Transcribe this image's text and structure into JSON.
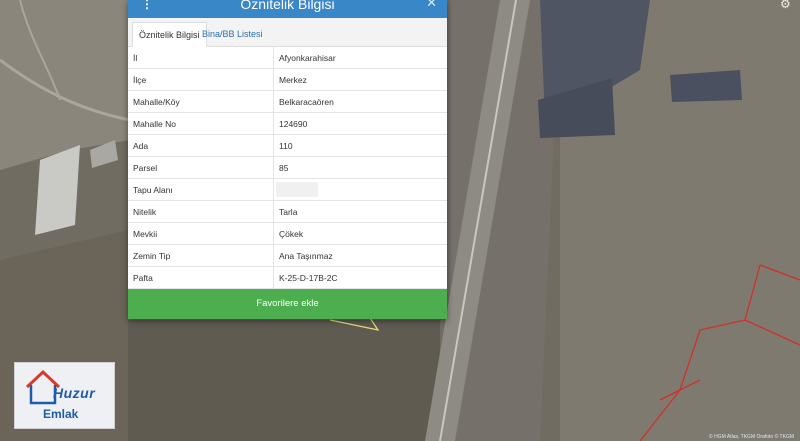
{
  "panel": {
    "title": "Öznitelik Bilgisi",
    "tabs": [
      "Öznitelik Bilgisi",
      "Bina/BB Listesi"
    ],
    "rows": [
      {
        "label": "İl",
        "value": "Afyonkarahisar"
      },
      {
        "label": "İlçe",
        "value": "Merkez"
      },
      {
        "label": "Mahalle/Köy",
        "value": "Belkaracaören"
      },
      {
        "label": "Mahalle No",
        "value": "124690"
      },
      {
        "label": "Ada",
        "value": "110"
      },
      {
        "label": "Parsel",
        "value": "85"
      },
      {
        "label": "Tapu Alanı",
        "value": ""
      },
      {
        "label": "Nitelik",
        "value": "Tarla"
      },
      {
        "label": "Mevkii",
        "value": "Çökek"
      },
      {
        "label": "Zemin Tip",
        "value": "Ana Taşınmaz"
      },
      {
        "label": "Pafta",
        "value": "K-25-D-17B-2C"
      }
    ],
    "favorite_button": "Favorilere ekle"
  },
  "logo": {
    "line1": "Huzur",
    "line2": "Emlak"
  },
  "map": {
    "attribution": "© HGM Atlas, TKGM Orafoto © TKGM"
  },
  "icons": {
    "menu": "menu-dots-icon",
    "close": "close-icon",
    "settings": "gear-icon"
  },
  "colors": {
    "header": "#3a87c8",
    "button": "#4cae4f",
    "parcel_outline": "#e6e07a",
    "boundary": "#d0302a"
  }
}
